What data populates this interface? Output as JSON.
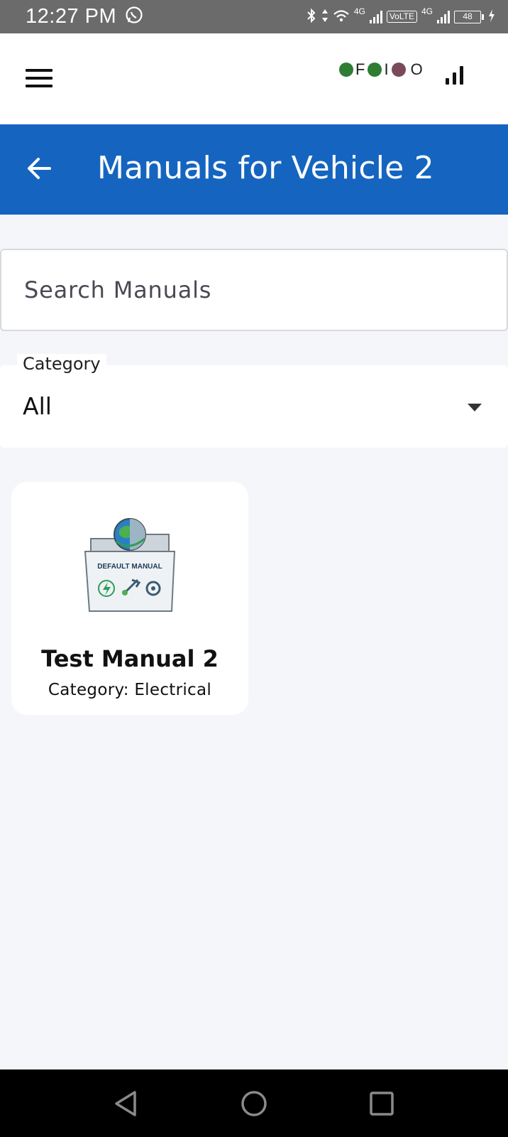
{
  "status_bar": {
    "time": "12:27 PM",
    "network_label_1": "4G",
    "volte_label": "VoLTE",
    "network_label_2": "4G",
    "battery": "48"
  },
  "top_bar": {
    "legend": [
      {
        "label": "F",
        "color": "#2e7d32"
      },
      {
        "label": "I",
        "color": "#2e7d32"
      },
      {
        "label": "O",
        "color": "#7b4a5a"
      }
    ]
  },
  "header": {
    "title": "Manuals for Vehicle 2",
    "color": "#1565c0"
  },
  "search": {
    "placeholder": "Search Manuals"
  },
  "category_filter": {
    "label": "Category",
    "value": "All"
  },
  "manuals": [
    {
      "title": "Test Manual 2",
      "category": "Category: Electrical",
      "thumbnail_text": "DEFAULT MANUAL"
    }
  ]
}
